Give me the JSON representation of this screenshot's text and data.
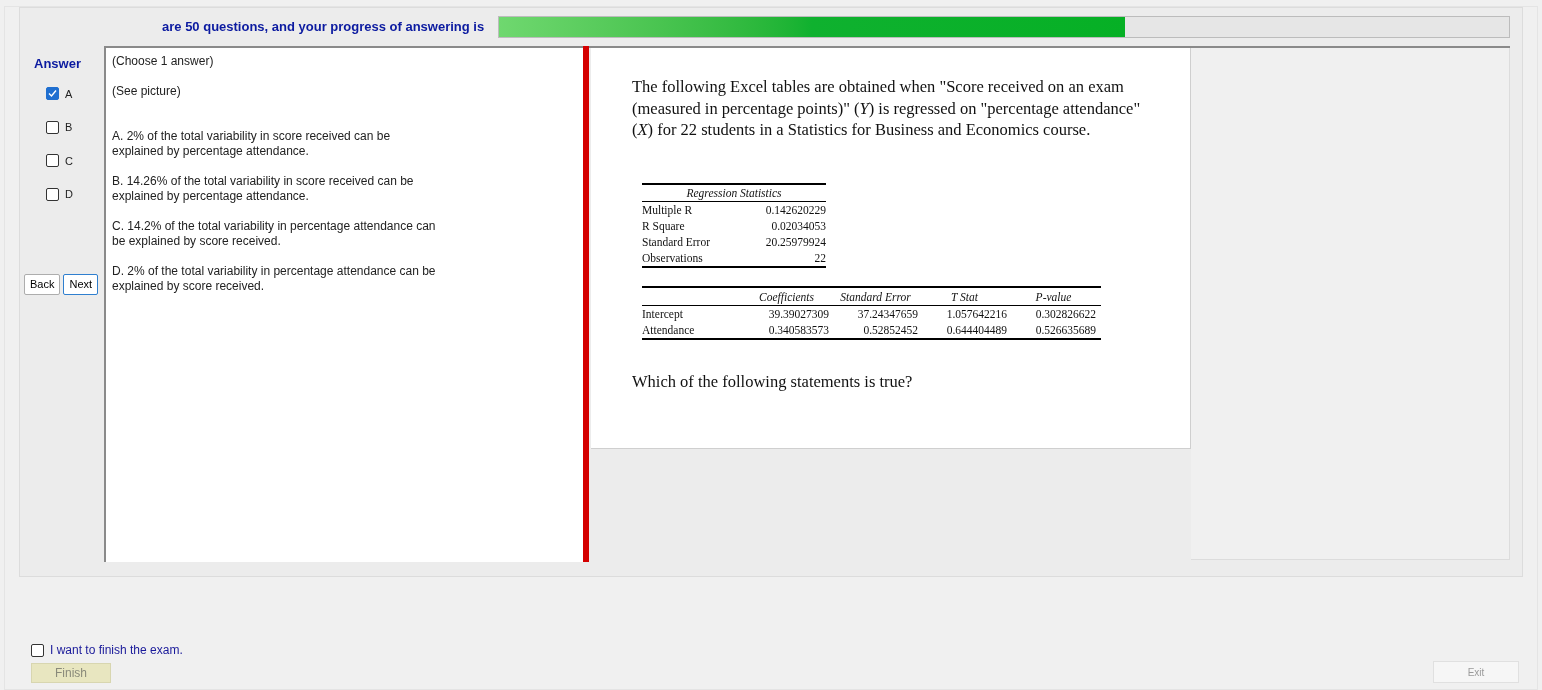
{
  "header": {
    "progress_text": "are 50 questions, and your progress of answering is",
    "progress": {
      "level": 0.62
    }
  },
  "answer_panel": {
    "title": "Answer",
    "options": [
      {
        "label": "A",
        "checked": true
      },
      {
        "label": "B",
        "checked": false
      },
      {
        "label": "C",
        "checked": false
      },
      {
        "label": "D",
        "checked": false
      }
    ],
    "buttons": [
      {
        "label": "Back",
        "selected": false
      },
      {
        "label": "Next",
        "selected": true
      }
    ]
  },
  "question_text": [
    "(Choose 1 answer)",
    "(See picture)",
    "A.  2% of the total variability in score received can be explained by percentage attendance.",
    "B.  14.26% of the total variability in score received can be explained by percentage attendance.",
    "C.  14.2% of the total variability in percentage attendance can be explained by score received.",
    "D.  2% of the total variability in percentage attendance can be explained by score received."
  ],
  "picture": {
    "intro": "The following Excel tables are obtained when \"Score received on an exam (measured in percentage points)\" (*Y*) is regressed on \"percentage attendance\" (*X*) for 22 students in a Statistics for Business and Economics course.",
    "stats_title": "Regression Statistics",
    "stats": [
      [
        "Multiple R",
        "0.142620229"
      ],
      [
        "R Square",
        "0.02034053"
      ],
      [
        "Standard Error",
        "20.25979924"
      ],
      [
        "Observations",
        "22"
      ]
    ],
    "coef_columns": [
      "Coefficients",
      "Standard Error",
      "T Stat",
      "P-value"
    ],
    "coef_rows": [
      [
        "Intercept",
        "39.39027309",
        "37.24347659",
        "1.057642216",
        "0.302826622"
      ],
      [
        "Attendance",
        "0.340583573",
        "0.52852452",
        "0.644404489",
        "0.526635689"
      ]
    ],
    "question": "Which of the following statements is true?"
  },
  "footer": {
    "finish_check": {
      "label": "I want to finish the exam.",
      "checked": false
    },
    "finish_button": {
      "label": "Finish",
      "disabled": true
    },
    "exit_button": {
      "label": "Exit",
      "disabled": true
    }
  }
}
